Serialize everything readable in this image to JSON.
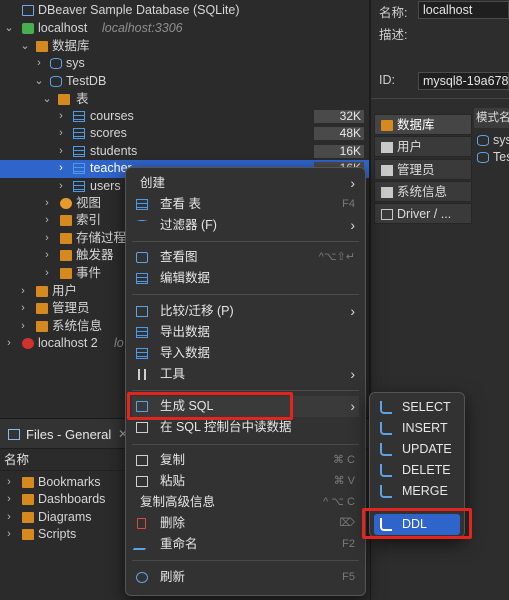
{
  "navigator": {
    "db_title": "DBeaver Sample Database (SQLite)",
    "conn_name": "localhost",
    "conn_host": "localhost:3306",
    "databases_label": "数据库",
    "sys_label": "sys",
    "testdb_label": "TestDB",
    "tables_label": "表",
    "tables": [
      {
        "name": "courses",
        "size": "32K"
      },
      {
        "name": "scores",
        "size": "48K"
      },
      {
        "name": "students",
        "size": "16K"
      },
      {
        "name": "teacher",
        "size": "16K"
      },
      {
        "name": "users",
        "size": ""
      }
    ],
    "views_label": "视图",
    "indexes_label": "索引",
    "procedures_label": "存储过程",
    "triggers_label": "触发器",
    "events_label": "事件",
    "users_label": "用户",
    "admins_label": "管理员",
    "sysinfo_label": "系统信息",
    "conn2_name": "localhost 2",
    "conn2_host": "lo"
  },
  "files": {
    "tab_title": "Files - General",
    "close_glyph": "✕",
    "column_name": "名称",
    "items": [
      "Bookmarks",
      "Dashboards",
      "Diagrams",
      "Scripts"
    ]
  },
  "right": {
    "name_label": "名称:",
    "name_value": "localhost",
    "desc_label": "描述:",
    "id_label": "ID:",
    "id_value": "mysql8-19a678t",
    "tabs": [
      "数据库",
      "用户",
      "管理员",
      "系统信息",
      "Driver / ..."
    ],
    "schema_header": "模式名称",
    "schemas": [
      "sys",
      "TestDB"
    ]
  },
  "context_menu": {
    "create": "创建",
    "view_table": "查看 表",
    "view_table_sc": "F4",
    "filter": "过滤器 (F)",
    "view_diagram": "查看图",
    "view_diagram_sc": "^⌥⇧↵",
    "edit_data": "编辑数据",
    "compare": "比较/迁移 (P)",
    "export": "导出数据",
    "import": "导入数据",
    "tools": "工具",
    "gen_sql": "生成 SQL",
    "read_console": "在 SQL 控制台中读数据",
    "copy": "复制",
    "copy_sc": "⌘ C",
    "paste": "粘贴",
    "paste_sc": "⌘ V",
    "copy_adv": "复制高级信息",
    "copy_adv_sc": "^ ⌥ C",
    "delete": "删除",
    "delete_sc": "⌦",
    "rename": "重命名",
    "rename_sc": "F2",
    "refresh": "刷新",
    "refresh_sc": "F5",
    "submenu_glyph": "›"
  },
  "sql_submenu": {
    "items": [
      "SELECT",
      "INSERT",
      "UPDATE",
      "DELETE",
      "MERGE",
      "DDL"
    ]
  },
  "tree_glyphs": {
    "expanded": "⌄",
    "collapsed": "›"
  },
  "colors": {
    "selection": "#2f65ca",
    "highlight_box": "#e4251d",
    "folder": "#d6891e",
    "table_icon": "#4d9be6"
  }
}
